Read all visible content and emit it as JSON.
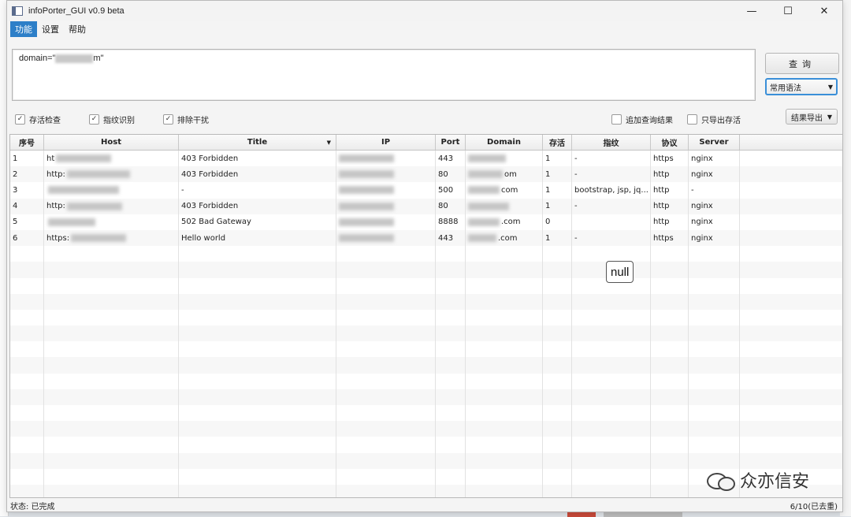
{
  "window": {
    "title": "infoPorter_GUI v0.9 beta",
    "controls": {
      "minimize": "—",
      "maximize": "☐",
      "close": "✕"
    }
  },
  "menu": [
    {
      "label": "功能",
      "active": true
    },
    {
      "label": "设置",
      "active": false
    },
    {
      "label": "帮助",
      "active": false
    }
  ],
  "query": {
    "prefix": "domain=\"",
    "suffix": "m\"",
    "button_label": "查询",
    "syntax_select": "常用语法"
  },
  "options": [
    {
      "label": "存活检查",
      "checked": true
    },
    {
      "label": "指纹识别",
      "checked": true
    },
    {
      "label": "排除干扰",
      "checked": true
    },
    {
      "label": "追加查询结果",
      "checked": false
    },
    {
      "label": "只导出存活",
      "checked": false
    }
  ],
  "export_button": "结果导出",
  "table": {
    "columns": [
      "序号",
      "Host",
      "Title",
      "IP",
      "Port",
      "Domain",
      "存活",
      "指纹",
      "协议",
      "Server",
      ""
    ],
    "rows": [
      {
        "no": "1",
        "host": "ht",
        "title": "403 Forbidden",
        "port": "443",
        "domain": "",
        "alive": "1",
        "fingerprint": "-",
        "protocol": "https",
        "server": "nginx"
      },
      {
        "no": "2",
        "host": "http:",
        "title": "403 Forbidden",
        "port": "80",
        "domain": "om",
        "alive": "1",
        "fingerprint": "-",
        "protocol": "http",
        "server": "nginx"
      },
      {
        "no": "3",
        "host": "",
        "title": "-",
        "port": "500",
        "domain": "com",
        "alive": "1",
        "fingerprint": "bootstrap, jsp, jq...",
        "protocol": "http",
        "server": "-"
      },
      {
        "no": "4",
        "host": "http:",
        "title": "403 Forbidden",
        "port": "80",
        "domain": "",
        "alive": "1",
        "fingerprint": "-",
        "protocol": "http",
        "server": "nginx"
      },
      {
        "no": "5",
        "host": "",
        "title": "502 Bad Gateway",
        "port": "8888",
        "domain": ".com",
        "alive": "0",
        "fingerprint": "",
        "protocol": "http",
        "server": "nginx"
      },
      {
        "no": "6",
        "host": "https:",
        "title": "Hello world",
        "port": "443",
        "domain": ".com",
        "alive": "1",
        "fingerprint": "-",
        "protocol": "https",
        "server": "nginx"
      }
    ],
    "empty_rows": 16
  },
  "tooltip": "null",
  "watermark": "众亦信安",
  "status": {
    "left": "状态: 已完成",
    "right": "6/10(已去重)"
  },
  "colors": {
    "accent": "#2d7fc8",
    "focus_border": "#3a8fd8"
  }
}
